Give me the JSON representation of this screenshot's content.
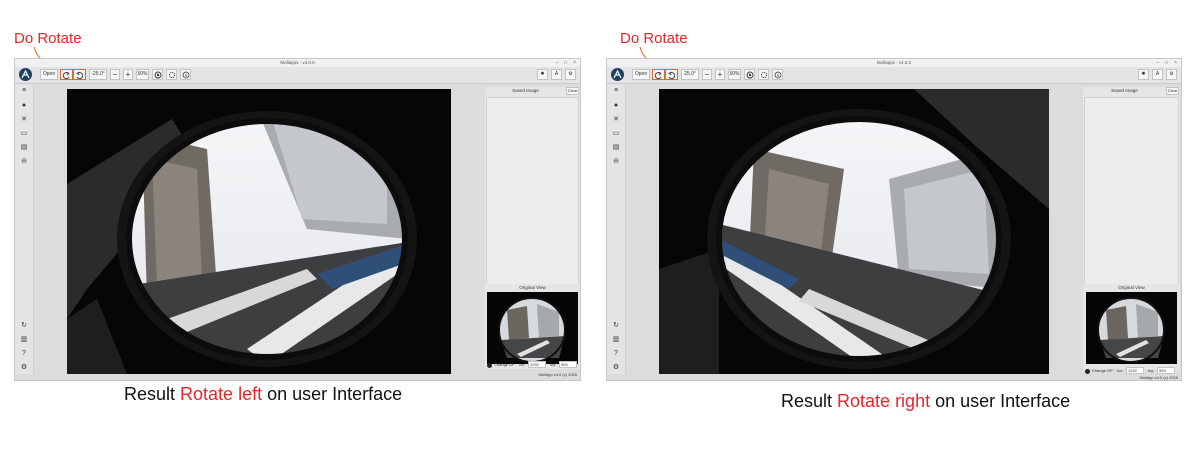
{
  "panels": [
    {
      "callout": "Do Rotate",
      "caption_prefix": "Result ",
      "caption_highlight": "Rotate left",
      "caption_suffix": " on user Interface",
      "window": {
        "title": "Mollapps - v4.0.0",
        "open_label": "Open",
        "angle_value": "-25.0°",
        "zoom_value": "50%",
        "saved_image_label": "Saved Image",
        "clear_label": "Clear",
        "original_view_label": "Original View",
        "change_dp_label": "Change DP",
        "icx_label": "Icx:",
        "icx_value": "1292",
        "icy_label": "Icy:",
        "icy_value": "959",
        "footer": "Moildpp v4.0 (c) 2025"
      },
      "highlighted_button": "rotate-left"
    },
    {
      "callout": "Do Rotate",
      "caption_prefix": "Result ",
      "caption_highlight": "Rotate right",
      "caption_suffix": " on user Interface",
      "window": {
        "title": "Mollapps - v4.0.0",
        "open_label": "Open",
        "angle_value": "25.0°",
        "zoom_value": "50%",
        "saved_image_label": "Saved Image",
        "clear_label": "Clear",
        "original_view_label": "Original View",
        "change_dp_label": "Change DP",
        "icx_label": "Icx:",
        "icx_value": "1292",
        "icy_label": "Icy:",
        "icy_value": "959",
        "footer": "Moildpp v4.0 (c) 2025"
      },
      "highlighted_button": "rotate-right"
    }
  ],
  "colors": {
    "callout": "#e8252a",
    "highlight_box": "#e0692d",
    "logo": "#1f3f63",
    "window_bg": "#dcdcde"
  }
}
